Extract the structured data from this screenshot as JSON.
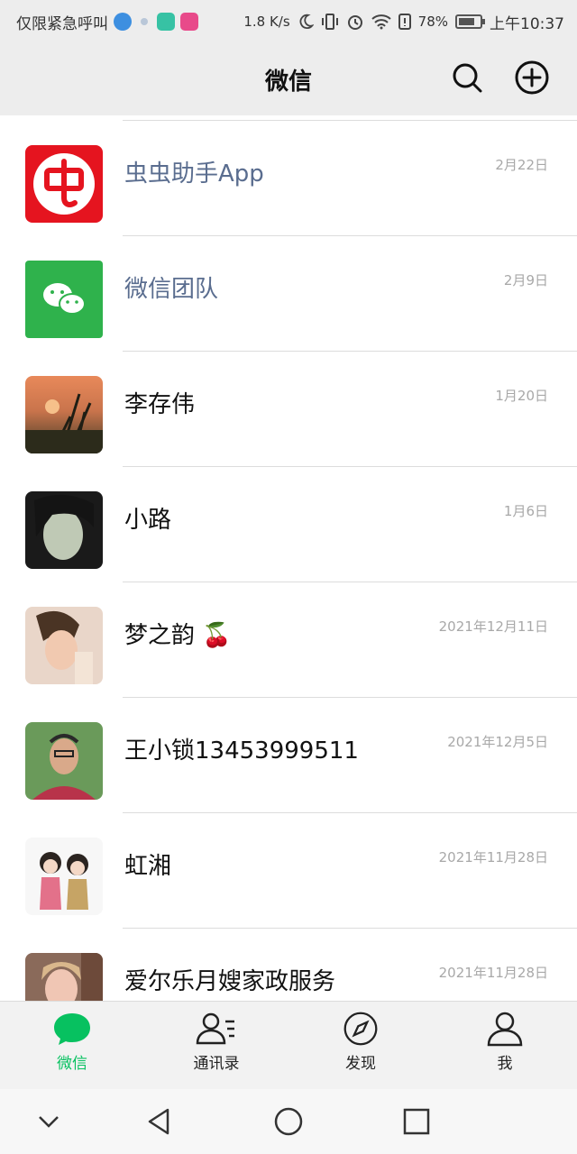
{
  "status_bar": {
    "carrier": "仅限紧急呼叫",
    "speed": "1.8 K/s",
    "battery": "78%",
    "battery_level": 0.78,
    "time": "上午10:37"
  },
  "header": {
    "title": "微信"
  },
  "chats": [
    {
      "name": "虫虫助手App",
      "date": "2月22日",
      "official": true,
      "avatar": "chongchong-logo"
    },
    {
      "name": "微信团队",
      "date": "2月9日",
      "official": true,
      "avatar": "wechat-logo"
    },
    {
      "name": "李存伟",
      "date": "1月20日",
      "official": false,
      "avatar": "sunset-photo"
    },
    {
      "name": "小路",
      "date": "1月6日",
      "official": false,
      "avatar": "portrait-photo"
    },
    {
      "name": "梦之韵 🍒",
      "date": "2021年12月11日",
      "official": false,
      "avatar": "portrait-photo"
    },
    {
      "name": "王小锁13453999511",
      "date": "2021年12月5日",
      "official": false,
      "avatar": "portrait-photo"
    },
    {
      "name": "虹湘",
      "date": "2021年11月28日",
      "official": false,
      "avatar": "cartoon-photo"
    },
    {
      "name": "爱尔乐月嫂家政服务",
      "date": "2021年11月28日",
      "official": false,
      "avatar": "portrait-photo"
    }
  ],
  "tabs": [
    {
      "label": "微信",
      "icon": "chat-bubble-icon",
      "active": true
    },
    {
      "label": "通讯录",
      "icon": "contacts-icon",
      "active": false
    },
    {
      "label": "发现",
      "icon": "compass-icon",
      "active": false
    },
    {
      "label": "我",
      "icon": "person-icon",
      "active": false
    }
  ],
  "colors": {
    "accent": "#07c160",
    "header_bg": "#ededed",
    "official_name": "#5a6d8f",
    "date": "#a8a8a8"
  }
}
